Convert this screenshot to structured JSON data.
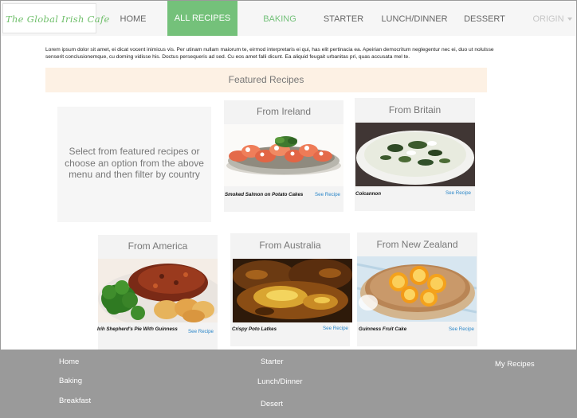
{
  "brand": {
    "name": "The Global Irish Cafe",
    "color": "#74c17a"
  },
  "nav": {
    "items": [
      {
        "label": "HOME"
      },
      {
        "label": "ALL RECIPES",
        "active": true
      },
      {
        "label": "BAKING"
      },
      {
        "label": "STARTER"
      },
      {
        "label": "LUNCH/DINNER"
      },
      {
        "label": "DESSERT"
      }
    ],
    "origin_label": "ORIGIN"
  },
  "intro_text": "Lorem ipsum dolor sit amet, ei dicat vocent inimicus vis. Per utinam nullam maiorum te, eirmod interpretaris ei qui, has elit pertinacia ea. Apeirian democritum neglegentur nec ei, duo ut nolulsse senserit conclusionemque, cu doming vidisse his. Doctus persequeris ad sed. Cu eos amet falli dicunt. Ea aliquid feugait urbanitas pri, quas accusata mel te.",
  "featured_heading": "Featured Recipes",
  "select_prompt": "Select from featured recipes or choose an option from the above menu and then filter by country",
  "cards": [
    {
      "title": "From Ireland",
      "recipe": "Smoked Salmon on Potato Cakes",
      "link": "See Recipe",
      "image": "smoked-salmon-photo"
    },
    {
      "title": "From Britain",
      "recipe": "Colcannon",
      "link": "See Recipe",
      "image": "colcannon-photo"
    },
    {
      "title": "From America",
      "recipe": "Irih Shepherd's Pie With Guinness",
      "link": "See Recipe",
      "image": "shepherds-pie-photo"
    },
    {
      "title": "From Australia",
      "recipe": "Crispy Poto Latkes",
      "link": "See Recipe",
      "image": "potato-latkes-photo"
    },
    {
      "title": "From New Zealand",
      "recipe": "Guinness Fruit Cake",
      "link": "See Recipe",
      "image": "fruit-cake-photo"
    }
  ],
  "footer": {
    "col1": [
      "Home",
      "Baking",
      "Breakfast"
    ],
    "col2": [
      "Starter",
      "Lunch/Dinner",
      "Desert"
    ],
    "col3": [
      "My Recipes"
    ]
  }
}
